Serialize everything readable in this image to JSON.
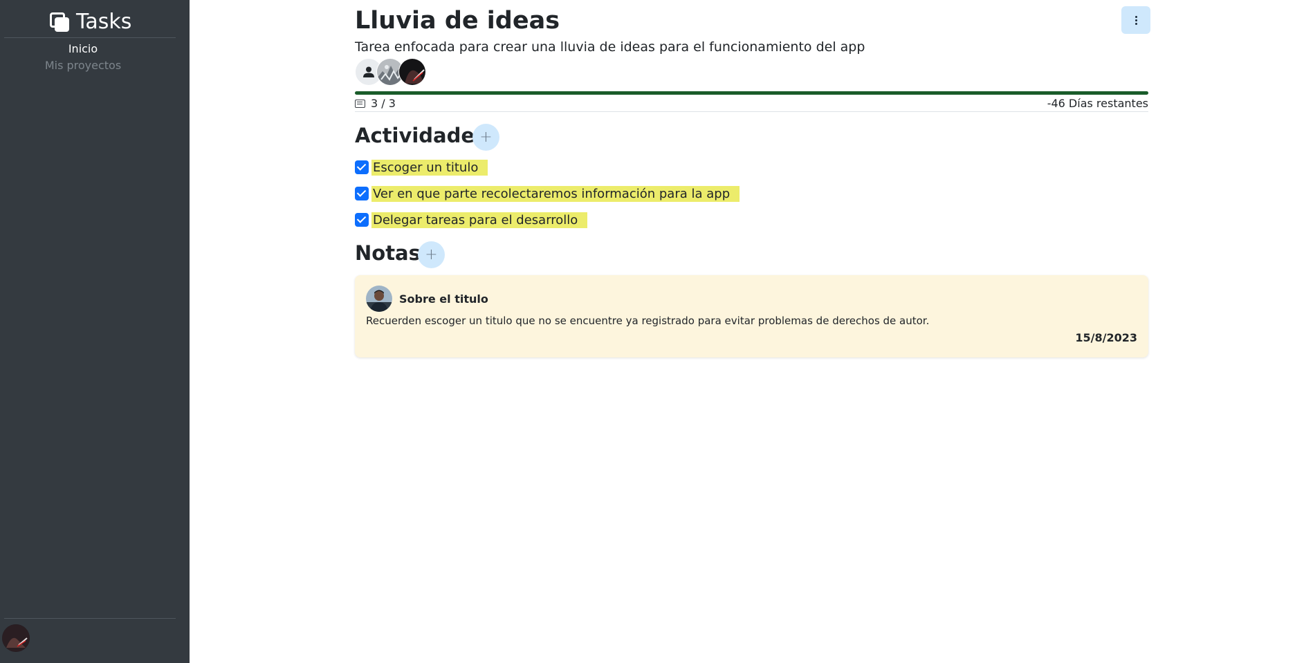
{
  "sidebar": {
    "brand": "Tasks",
    "nav": {
      "home": "Inicio",
      "projects": "Mis proyectos"
    }
  },
  "task": {
    "title": "Lluvia de ideas",
    "description": "Tarea enfocada para crear una lluvia de ideas para el funcionamiento del app",
    "progress_percent": 100,
    "task_count": "3 / 3",
    "days_left": "-46 Días restantes"
  },
  "activities": {
    "heading": "Actividades",
    "add_label": "+",
    "items": [
      {
        "label": "Escoger un titulo",
        "checked": true
      },
      {
        "label": "Ver en que parte recolectaremos información para la app",
        "checked": true
      },
      {
        "label": "Delegar tareas para el desarrollo",
        "checked": true
      }
    ]
  },
  "notes": {
    "heading": "Notas",
    "add_label": "+",
    "items": [
      {
        "title": "Sobre el titulo",
        "body": "Recuerden escoger un titulo que no se encuentre ya registrado para evitar problemas de derechos de autor.",
        "date": "15/8/2023"
      }
    ]
  },
  "colors": {
    "sidebar_bg": "#343a40",
    "accent": "#0d6efd",
    "progress": "#1a5c2a",
    "highlight": "#ecec6b",
    "note_bg": "#fdf5dd",
    "button_bg": "#cfe8fc"
  },
  "icons": {
    "brand": "tasks-logo-icon",
    "menu": "kebab-menu-icon",
    "count": "list-icon"
  }
}
